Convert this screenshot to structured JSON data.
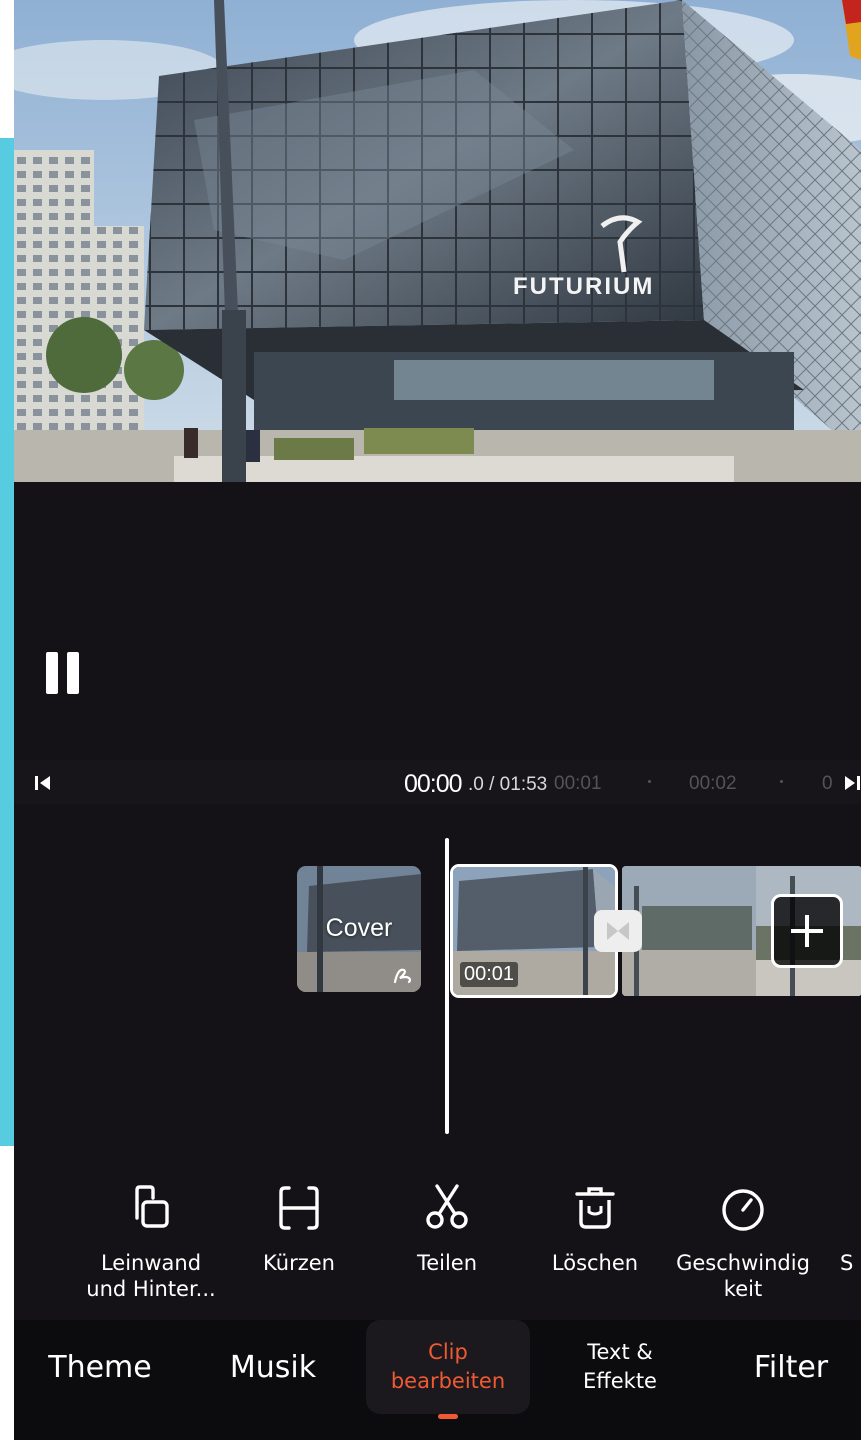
{
  "preview": {
    "building_sign": "FUTURIUM"
  },
  "player": {
    "pause_icon": "pause-icon"
  },
  "ruler": {
    "current_time": "00:00",
    "time_fraction": ".0 / 01:53",
    "tick_1": "00:01",
    "tick_2": "00:02",
    "tick_3": "0"
  },
  "timeline": {
    "cover_label": "Cover",
    "clip_time": "00:01"
  },
  "tools": [
    {
      "label": "Leinwand\nund Hinter...",
      "icon": "canvas-icon"
    },
    {
      "label": "Kürzen",
      "icon": "trim-icon"
    },
    {
      "label": "Teilen",
      "icon": "scissors-icon"
    },
    {
      "label": "Löschen",
      "icon": "trash-icon"
    },
    {
      "label": "Geschwindig\nkeit",
      "icon": "speed-icon"
    },
    {
      "label": "S",
      "icon": ""
    }
  ],
  "nav": {
    "tabs": [
      {
        "label": "Theme",
        "active": false
      },
      {
        "label": "Musik",
        "active": false
      },
      {
        "label": "Clip\nbearbeiten",
        "active": true
      },
      {
        "label": "Text &\nEffekte",
        "active": false
      },
      {
        "label": "Filter",
        "active": false
      }
    ]
  },
  "colors": {
    "accent": "#ef5a33",
    "background": "#141216",
    "nav_background": "#0c0b0e",
    "side_strip": "#57cbe0"
  }
}
